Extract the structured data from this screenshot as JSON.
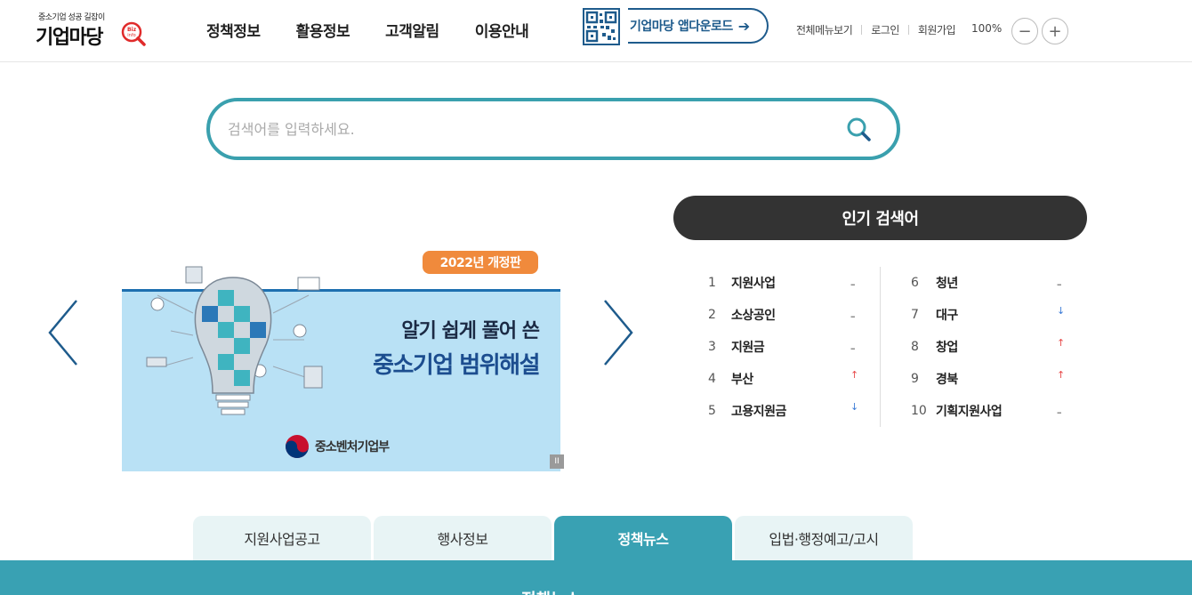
{
  "header": {
    "logo": {
      "tagline": "중소기업 성공 길잡이",
      "brand": "기업마당",
      "badge": "Biz info"
    },
    "nav": [
      "정책정보",
      "활용정보",
      "고객알림",
      "이용안내"
    ],
    "app_download": "기업마당 앱다운로드",
    "util_links": [
      "전체메뉴보기",
      "로그인",
      "회원가입"
    ],
    "zoom_level": "100%",
    "zoom_out": "−",
    "zoom_in": "+"
  },
  "search": {
    "placeholder": "검색어를 입력하세요.",
    "value": ""
  },
  "banner": {
    "edition": "2022년 개정판",
    "line1": "알기 쉽게 풀어 쓴",
    "line2": "중소기업 범위해설",
    "ministry": "중소벤처기업부",
    "pause": "II"
  },
  "popular": {
    "title": "인기 검색어",
    "left": [
      {
        "rank": "1",
        "keyword": "지원사업",
        "trend": "same"
      },
      {
        "rank": "2",
        "keyword": "소상공인",
        "trend": "same"
      },
      {
        "rank": "3",
        "keyword": "지원금",
        "trend": "same"
      },
      {
        "rank": "4",
        "keyword": "부산",
        "trend": "up"
      },
      {
        "rank": "5",
        "keyword": "고용지원금",
        "trend": "down"
      }
    ],
    "right": [
      {
        "rank": "6",
        "keyword": "청년",
        "trend": "same"
      },
      {
        "rank": "7",
        "keyword": "대구",
        "trend": "down"
      },
      {
        "rank": "8",
        "keyword": "창업",
        "trend": "up"
      },
      {
        "rank": "9",
        "keyword": "경북",
        "trend": "up"
      },
      {
        "rank": "10",
        "keyword": "기획지원사업",
        "trend": "same"
      }
    ]
  },
  "tabs": {
    "items": [
      "지원사업공고",
      "행사정보",
      "정책뉴스",
      "입법·행정예고/고시"
    ],
    "active_index": 2,
    "panel_title": "정책뉴스"
  },
  "icons": {
    "search": "search-icon",
    "prev": "chevron-left-icon",
    "next": "chevron-right-icon",
    "qr": "qr-code-icon",
    "arrow": "arrow-right-icon"
  },
  "colors": {
    "accent": "#3aa0ae",
    "tab_active": "#39a1b3",
    "brand_blue": "#1e5b8c",
    "edition_orange": "#f08a3c",
    "trend_up": "#e74a4a",
    "trend_down": "#3b7bd6"
  }
}
